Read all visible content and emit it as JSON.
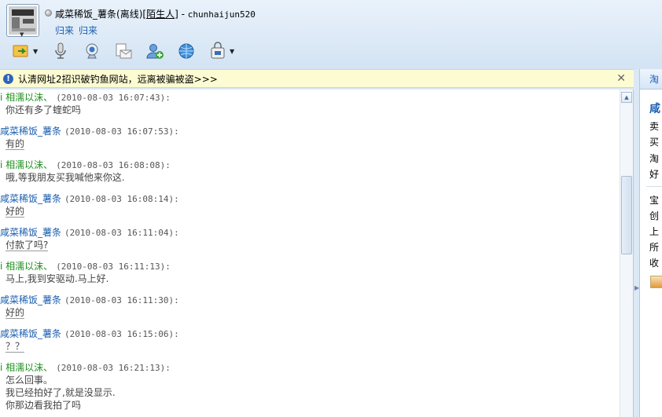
{
  "window": {
    "contact_name": "咸菜稀饭_薯条",
    "status": "(离线)",
    "stranger_label": "陌生人",
    "separator": " - ",
    "account": "chunhaijun520",
    "links": [
      "归来",
      "归来"
    ]
  },
  "toolbar": {
    "icons": [
      "send-file-icon",
      "microphone-icon",
      "webcam-icon",
      "email-icon",
      "add-contact-icon",
      "browser-icon",
      "shop-icon"
    ]
  },
  "warning": {
    "icon_glyph": "!",
    "text": "认清网址2招识破钓鱼网站，远离被骗被盗>>>",
    "close_glyph": "✕"
  },
  "messages": [
    {
      "sender": "相濡以沫、",
      "sender_prefix": "ⅰ",
      "time": "(2010-08-03 16:07:43):",
      "lines": [
        "你还有多了蝰蛇吗"
      ],
      "side": "green"
    },
    {
      "sender": "咸菜稀饭_薯条",
      "time": "(2010-08-03 16:07:53):",
      "lines": [
        "有的"
      ],
      "side": "blue"
    },
    {
      "sender": "相濡以沫、",
      "sender_prefix": "ⅰ",
      "time": "(2010-08-03 16:08:08):",
      "lines": [
        "哦,等我朋友买我喊他来你这."
      ],
      "side": "green"
    },
    {
      "sender": "咸菜稀饭_薯条",
      "time": "(2010-08-03 16:08:14):",
      "lines": [
        "好的"
      ],
      "side": "blue"
    },
    {
      "sender": "咸菜稀饭_薯条",
      "time": "(2010-08-03 16:11:04):",
      "lines": [
        "付款了吗?"
      ],
      "side": "blue"
    },
    {
      "sender": "相濡以沫、",
      "sender_prefix": "ⅰ",
      "time": "(2010-08-03 16:11:13):",
      "lines": [
        "马上,我到安驱动.马上好."
      ],
      "side": "green"
    },
    {
      "sender": "咸菜稀饭_薯条",
      "time": "(2010-08-03 16:11:30):",
      "lines": [
        "好的"
      ],
      "side": "blue"
    },
    {
      "sender": "咸菜稀饭_薯条",
      "time": "(2010-08-03 16:15:06):",
      "lines": [
        "？？"
      ],
      "side": "blue"
    },
    {
      "sender": "相濡以沫、",
      "sender_prefix": "ⅰ",
      "time": "(2010-08-03 16:21:13):",
      "lines": [
        "怎么回事。",
        "我已经拍好了,就是没显示.",
        "你那边看我拍了吗"
      ],
      "side": "green"
    }
  ],
  "side_panel": {
    "tab": "淘",
    "title": "咸",
    "lines": [
      "卖",
      "买",
      "淘",
      "好",
      "宝",
      "创",
      "上",
      "所",
      "收"
    ]
  }
}
